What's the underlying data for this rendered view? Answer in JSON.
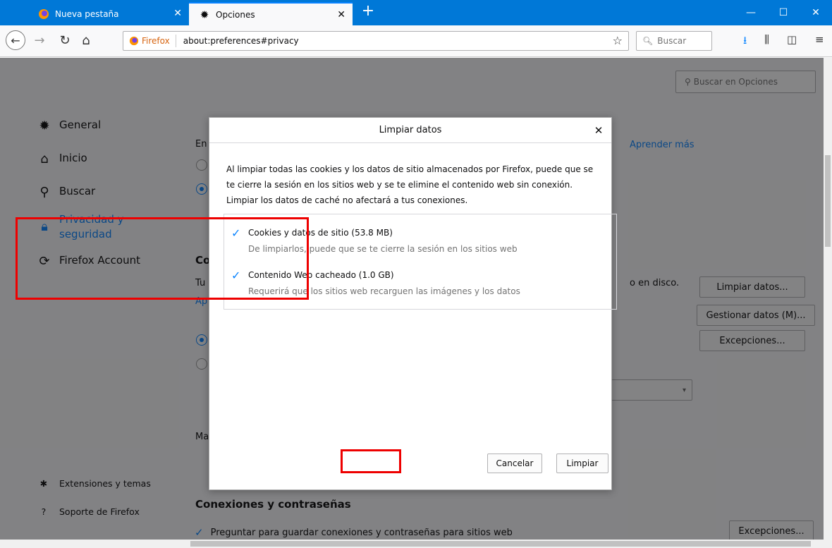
{
  "tabs": [
    {
      "label": "Nueva pestaña",
      "icon": "firefox-icon"
    },
    {
      "label": "Opciones",
      "icon": "gear-icon"
    }
  ],
  "nav": {
    "identity_label": "Firefox",
    "url": "about:preferences#privacy",
    "search_placeholder": "Buscar"
  },
  "prefs": {
    "search_placeholder": "Buscar en Opciones",
    "sidebar": [
      {
        "label": "General",
        "icon": "gear-icon"
      },
      {
        "label": "Inicio",
        "icon": "home-icon"
      },
      {
        "label": "Buscar",
        "icon": "search-icon"
      },
      {
        "label": "Privacidad y seguridad",
        "icon": "lock-icon"
      },
      {
        "label": "Firefox Account",
        "icon": "sync-icon"
      }
    ],
    "sidebar_bottom": [
      {
        "label": "Extensiones y temas",
        "icon": "puzzle-icon"
      },
      {
        "label": "Soporte de Firefox",
        "icon": "help-icon"
      }
    ],
    "learn_more": "Aprender más",
    "disk_text": "o en disco.",
    "partial_texts": [
      "En",
      "Co",
      "Tu",
      "Ap",
      "Ma"
    ],
    "buttons": {
      "clear_data": "Limpiar datos...",
      "manage_data": "Gestionar datos (M)...",
      "exceptions": "Excepciones...",
      "exceptions2": "Excepciones..."
    },
    "section_title": "Conexiones y contraseñas",
    "save_logins_label": "Preguntar para guardar conexiones y contraseñas para sitios web"
  },
  "dialog": {
    "title": "Limpiar datos",
    "description": "Al limpiar todas las cookies y los datos de sitio almacenados por Firefox, puede que se te cierre la sesión en los sitios web y se te elimine el contenido web sin conexión. Limpiar los datos de caché no afectará a tus conexiones.",
    "options": [
      {
        "label": "Cookies y datos de sitio (53.8 MB)",
        "hint": "De limpiarlos, puede que se te cierre la sesión en los sitios web",
        "checked": true
      },
      {
        "label": "Contenido Web cacheado (1.0 GB)",
        "hint": "Requerirá que los sitios web recarguen las imágenes y los datos",
        "checked": true
      }
    ],
    "cancel_label": "Cancelar",
    "clear_label": "Limpiar"
  }
}
